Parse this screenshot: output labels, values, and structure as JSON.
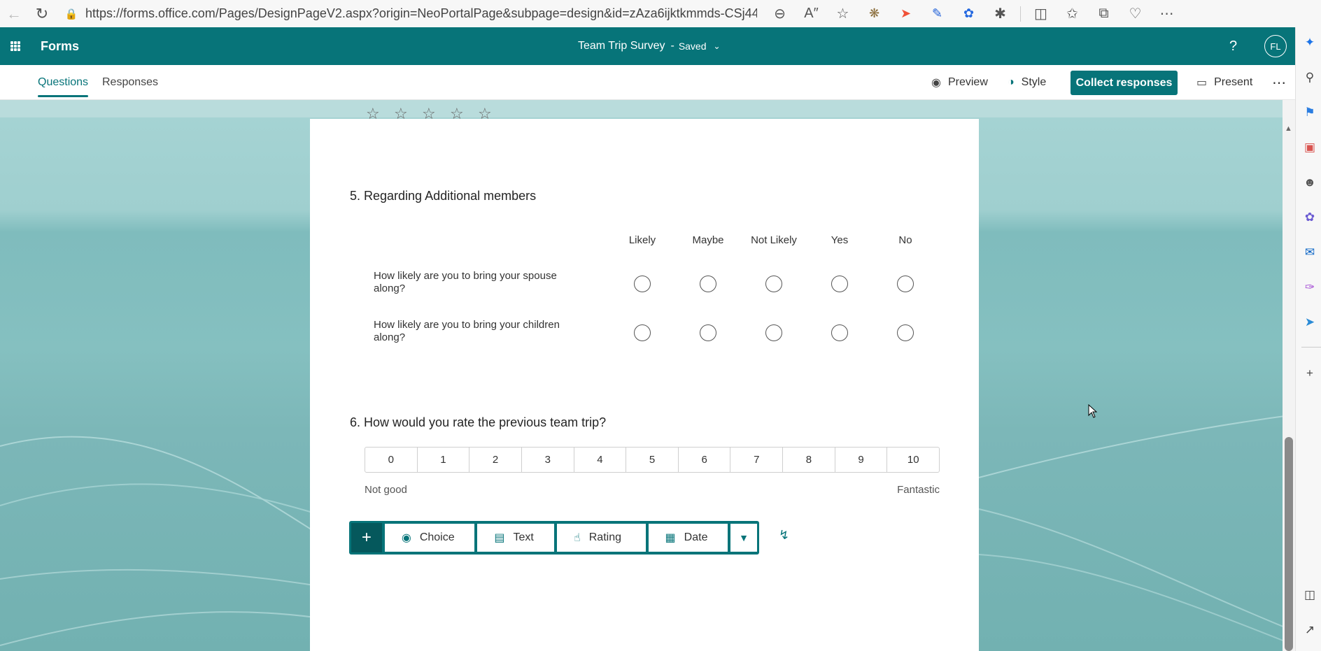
{
  "browser": {
    "url": "https://forms.office.com/Pages/DesignPageV2.aspx?origin=NeoPortalPage&subpage=design&id=zAza6ijktkmmds-CSj44U..."
  },
  "header": {
    "app_name": "Forms",
    "form_title": "Team Trip Survey",
    "separator": "-",
    "status": "Saved",
    "help": "?",
    "avatar_initials": "FL"
  },
  "command_bar": {
    "tabs": [
      {
        "label": "Questions"
      },
      {
        "label": "Responses"
      }
    ],
    "preview_label": "Preview",
    "style_label": "Style",
    "collect_label": "Collect responses",
    "present_label": "Present"
  },
  "questions": {
    "q5": {
      "title": "5. Regarding Additional members",
      "columns": [
        "Likely",
        "Maybe",
        "Not Likely",
        "Yes",
        "No"
      ],
      "statements": [
        "How likely are you to bring your spouse along?",
        "How likely are you to bring your children along?"
      ]
    },
    "q6": {
      "title": "6. How would you rate the previous team trip?",
      "scale": [
        "0",
        "1",
        "2",
        "3",
        "4",
        "5",
        "6",
        "7",
        "8",
        "9",
        "10"
      ],
      "low_label": "Not good",
      "high_label": "Fantastic"
    }
  },
  "add_toolbar": {
    "plus": "+",
    "types": [
      {
        "label": "Choice",
        "icon": "radio-icon"
      },
      {
        "label": "Text",
        "icon": "text-box-icon"
      },
      {
        "label": "Rating",
        "icon": "thumbs-up-icon"
      },
      {
        "label": "Date",
        "icon": "calendar-icon"
      }
    ]
  },
  "colors": {
    "brand": "#077479",
    "brand_dark": "#05585c"
  }
}
